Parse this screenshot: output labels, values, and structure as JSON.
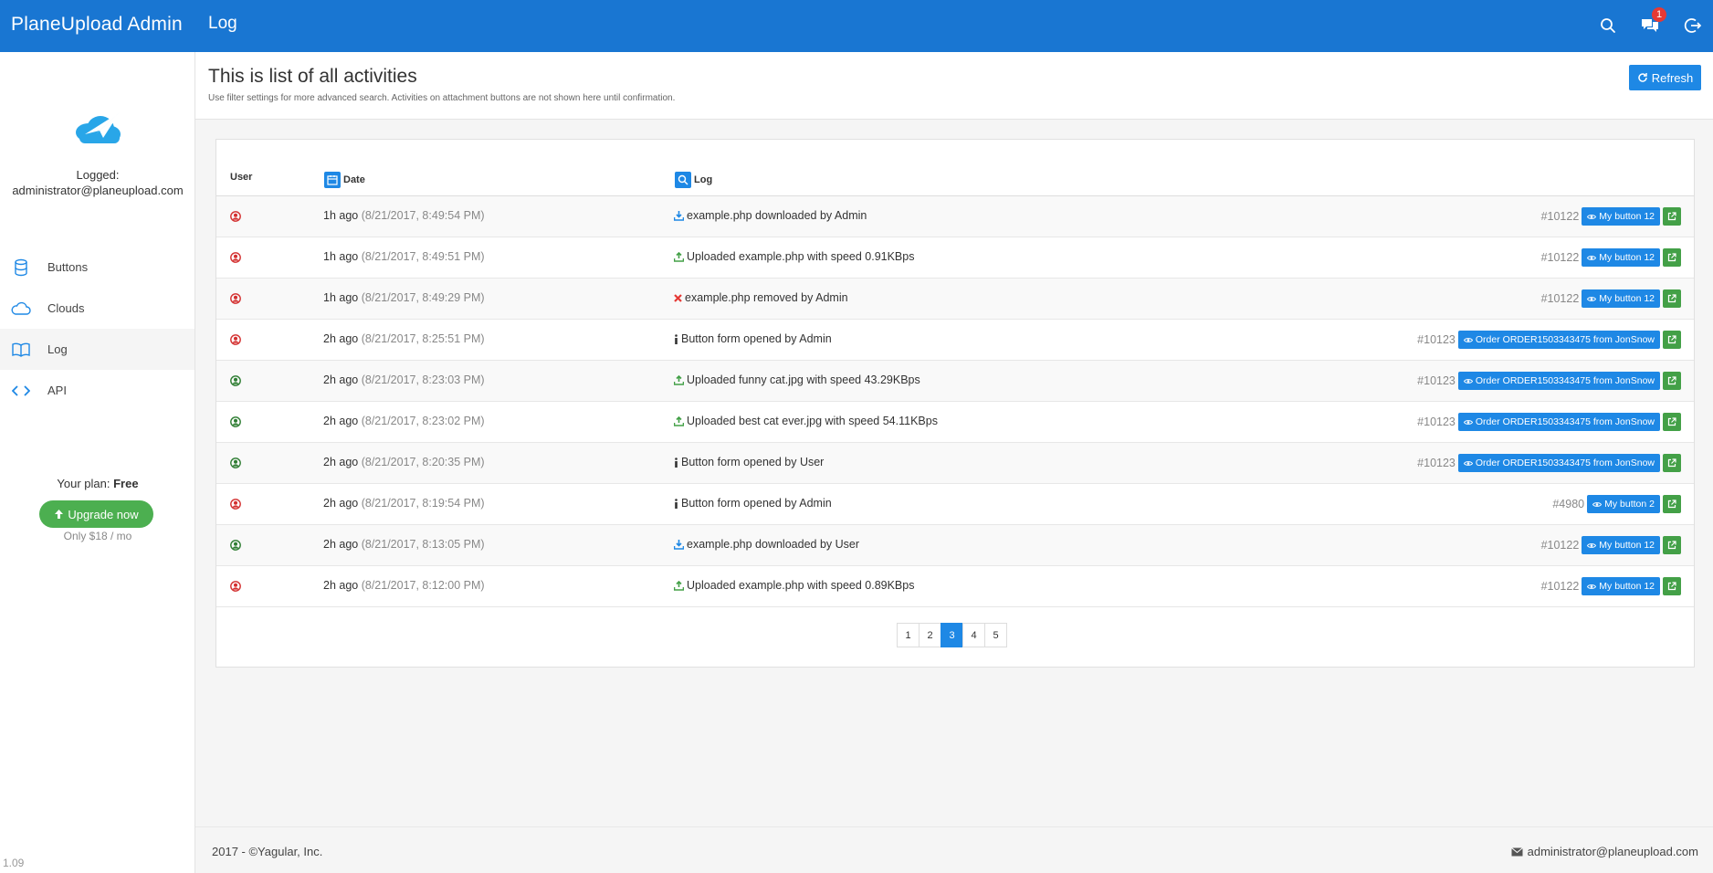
{
  "app": {
    "brand": "PlaneUpload Admin",
    "page": "Log",
    "notification_count": "1"
  },
  "sidebar": {
    "logged_label": "Logged:",
    "logged_email": "administrator@planeupload.com",
    "items": [
      {
        "label": "Buttons",
        "icon": "buttons-db-icon"
      },
      {
        "label": "Clouds",
        "icon": "cloud-icon"
      },
      {
        "label": "Log",
        "icon": "book-icon"
      },
      {
        "label": "API",
        "icon": "code-icon"
      }
    ],
    "plan_label": "Your plan:",
    "plan_value": "Free",
    "upgrade_label": "Upgrade now",
    "price": "Only $18 / mo",
    "version": "1.09"
  },
  "header": {
    "title": "This is list of all activities",
    "subtitle": "Use filter settings for more advanced search. Activities on attachment buttons are not shown here until confirmation.",
    "refresh_label": "Refresh"
  },
  "table": {
    "col_user": "User",
    "col_date": "Date",
    "col_log": "Log",
    "rows": [
      {
        "user_color": "#d32f2f",
        "ago": "1h ago",
        "ts": "(8/21/2017, 8:49:54 PM)",
        "icon": "download",
        "text": "example.php downloaded by Admin",
        "num": "#10122",
        "btn": "My button 12"
      },
      {
        "user_color": "#d32f2f",
        "ago": "1h ago",
        "ts": "(8/21/2017, 8:49:51 PM)",
        "icon": "upload",
        "text": "Uploaded example.php with speed 0.91KBps",
        "num": "#10122",
        "btn": "My button 12"
      },
      {
        "user_color": "#d32f2f",
        "ago": "1h ago",
        "ts": "(8/21/2017, 8:49:29 PM)",
        "icon": "remove",
        "text": "example.php removed by Admin",
        "num": "#10122",
        "btn": "My button 12"
      },
      {
        "user_color": "#d32f2f",
        "ago": "2h ago",
        "ts": "(8/21/2017, 8:25:51 PM)",
        "icon": "info",
        "text": "Button form opened by Admin",
        "num": "#10123",
        "btn": "Order ORDER1503343475 from JonSnow"
      },
      {
        "user_color": "#2e7d32",
        "ago": "2h ago",
        "ts": "(8/21/2017, 8:23:03 PM)",
        "icon": "upload",
        "text": "Uploaded funny cat.jpg with speed 43.29KBps",
        "num": "#10123",
        "btn": "Order ORDER1503343475 from JonSnow"
      },
      {
        "user_color": "#2e7d32",
        "ago": "2h ago",
        "ts": "(8/21/2017, 8:23:02 PM)",
        "icon": "upload",
        "text": "Uploaded best cat ever.jpg with speed 54.11KBps",
        "num": "#10123",
        "btn": "Order ORDER1503343475 from JonSnow"
      },
      {
        "user_color": "#2e7d32",
        "ago": "2h ago",
        "ts": "(8/21/2017, 8:20:35 PM)",
        "icon": "info",
        "text": "Button form opened by User",
        "num": "#10123",
        "btn": "Order ORDER1503343475 from JonSnow"
      },
      {
        "user_color": "#d32f2f",
        "ago": "2h ago",
        "ts": "(8/21/2017, 8:19:54 PM)",
        "icon": "info",
        "text": "Button form opened by Admin",
        "num": "#4980",
        "btn": "My button 2"
      },
      {
        "user_color": "#2e7d32",
        "ago": "2h ago",
        "ts": "(8/21/2017, 8:13:05 PM)",
        "icon": "download",
        "text": "example.php downloaded by User",
        "num": "#10122",
        "btn": "My button 12"
      },
      {
        "user_color": "#d32f2f",
        "ago": "2h ago",
        "ts": "(8/21/2017, 8:12:00 PM)",
        "icon": "upload",
        "text": "Uploaded example.php with speed 0.89KBps",
        "num": "#10122",
        "btn": "My button 12"
      }
    ]
  },
  "pagination": {
    "pages": [
      "1",
      "2",
      "3",
      "4",
      "5"
    ],
    "current": "3"
  },
  "footer": {
    "copyright": "2017 - ©Yagular, Inc.",
    "email": "administrator@planeupload.com"
  },
  "colors": {
    "topbar": "#1976d2",
    "primary_button": "#1e88e5",
    "success": "#4caf50",
    "badge": "#e53935"
  }
}
